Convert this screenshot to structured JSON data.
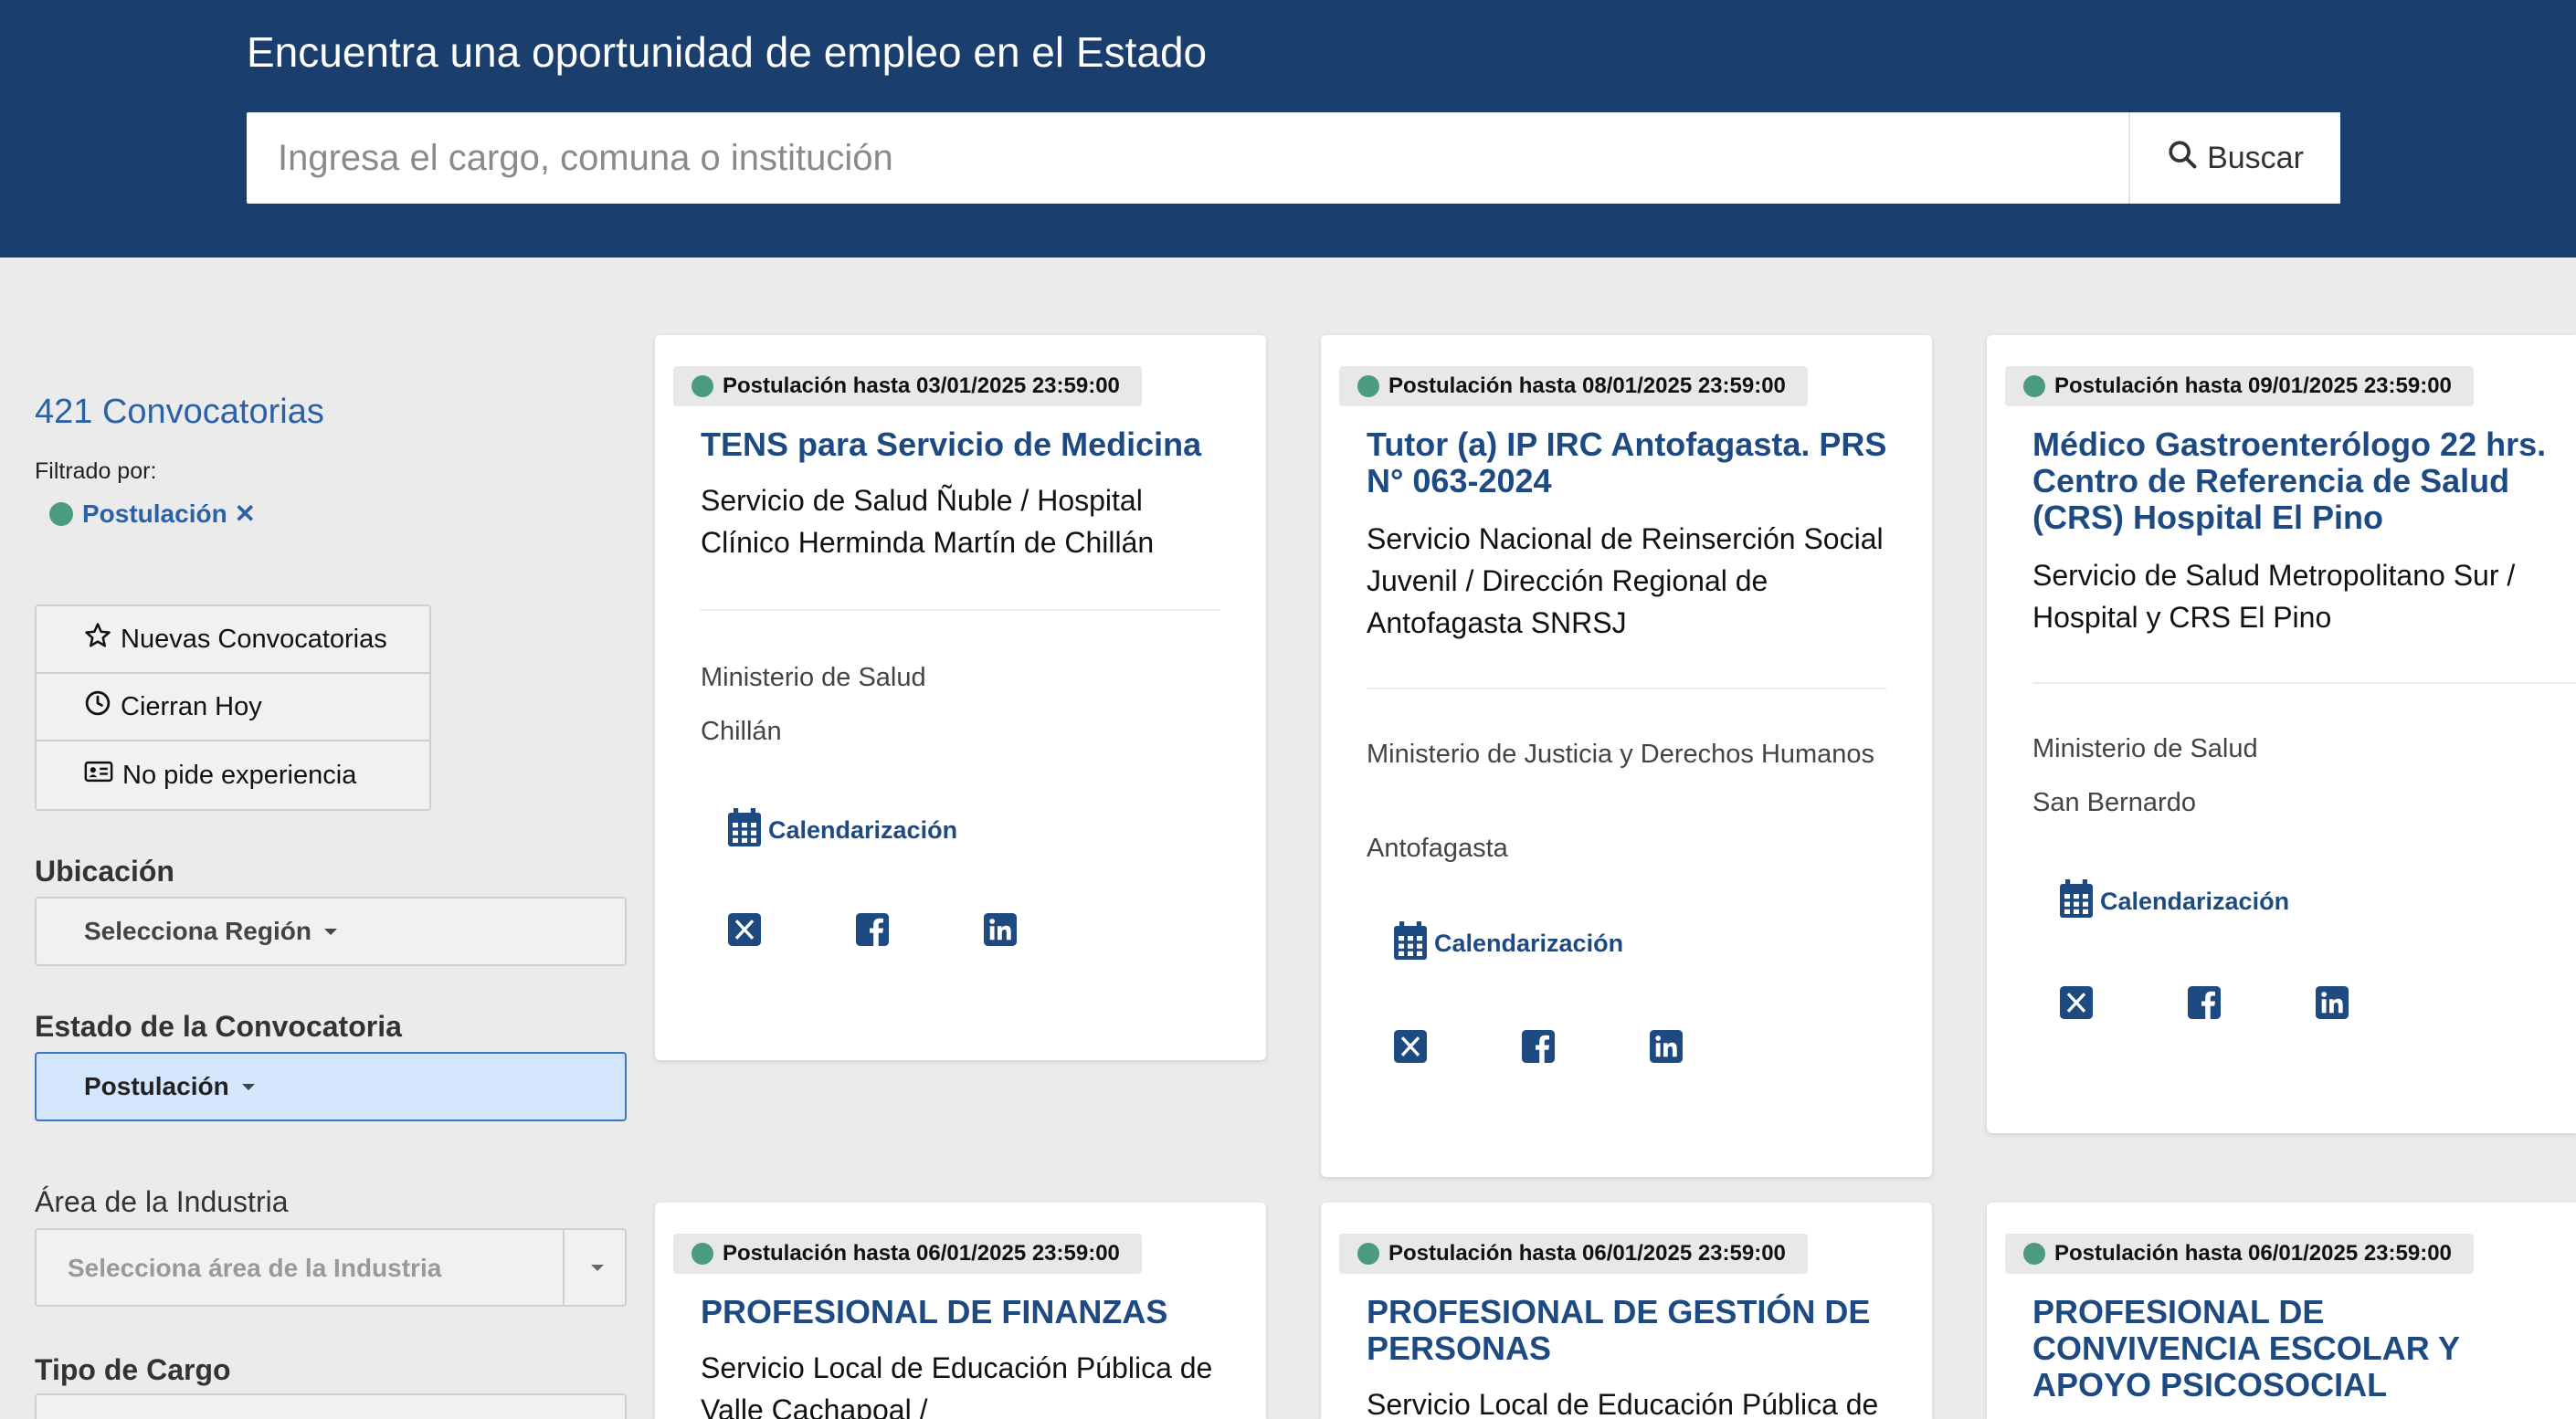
{
  "header": {
    "title": "Encuentra una oportunidad de empleo en el Estado",
    "search_placeholder": "Ingresa el cargo, comuna o institución",
    "search_button": "Buscar"
  },
  "sidebar": {
    "count": "421 Convocatorias",
    "filtered_by": "Filtrado por:",
    "active_filter": "Postulación ✕",
    "quick_filters": [
      "Nuevas Convocatorias",
      "Cierran Hoy",
      "No pide experiencia"
    ],
    "location_label": "Ubicación",
    "location_select": "Selecciona Región",
    "status_label": "Estado de la Convocatoria",
    "status_select": "Postulación",
    "industry_label": "Área de la Industria",
    "industry_placeholder": "Selecciona área de la Industria",
    "cargo_label": "Tipo de Cargo"
  },
  "colors": {
    "header_bg": "#1a3e6e",
    "accent": "#1e4a82",
    "status_dot": "#4b9b7e",
    "link": "#2a62a8"
  },
  "cards": [
    {
      "deadline": "Postulación hasta 03/01/2025 23:59:00",
      "title": "TENS para Servicio de Medicina",
      "institution": "Servicio de Salud Ñuble / Hospital Clínico Herminda Martín de Chillán",
      "ministry": "Ministerio de Salud",
      "city": "Chillán",
      "calendar": "Calendarización"
    },
    {
      "deadline": "Postulación hasta 08/01/2025 23:59:00",
      "title": "Tutor (a) IP IRC Antofagasta. PRS N° 063-2024",
      "institution": "Servicio Nacional de Reinserción Social Juvenil / Dirección Regional de Antofagasta SNRSJ",
      "ministry": "Ministerio de Justicia y Derechos Humanos",
      "city": "Antofagasta",
      "calendar": "Calendarización"
    },
    {
      "deadline": "Postulación hasta 09/01/2025 23:59:00",
      "title": "Médico Gastroenterólogo 22 hrs. Centro de Referencia de Salud (CRS) Hospital El Pino",
      "institution": "Servicio de Salud Metropolitano Sur / Hospital y CRS El Pino",
      "ministry": "Ministerio de Salud",
      "city": "San Bernardo",
      "calendar": "Calendarización"
    },
    {
      "deadline": "Postulación hasta 06/01/2025 23:59:00",
      "title": "PROFESIONAL DE FINANZAS",
      "institution": "Servicio Local de Educación Pública de Valle Cachapoal /"
    },
    {
      "deadline": "Postulación hasta 06/01/2025 23:59:00",
      "title": "PROFESIONAL DE GESTIÓN DE PERSONAS",
      "institution": "Servicio Local de Educación Pública de"
    },
    {
      "deadline": "Postulación hasta 06/01/2025 23:59:00",
      "title": "PROFESIONAL DE CONVIVENCIA ESCOLAR Y APOYO PSICOSOCIAL"
    }
  ],
  "icons": [
    "search-icon",
    "star-icon",
    "clock-icon",
    "id-card-icon",
    "calendar-icon",
    "x-twitter-icon",
    "facebook-icon",
    "linkedin-icon"
  ]
}
